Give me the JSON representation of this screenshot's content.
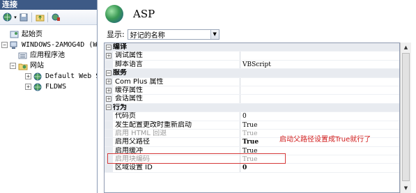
{
  "left_pane": {
    "title": "连接",
    "tree": [
      {
        "label": "起始页",
        "expander": "",
        "icon": "start-page-icon",
        "indent": 1
      },
      {
        "label": "WINDOWS-2AMOG4D (WIN",
        "expander": "⊟",
        "icon": "server-icon",
        "indent": 0
      },
      {
        "label": "应用程序池",
        "expander": "",
        "icon": "app-pool-icon",
        "indent": 2
      },
      {
        "label": "网站",
        "expander": "⊟",
        "icon": "sites-folder-icon",
        "indent": 1
      },
      {
        "label": "Default Web S:",
        "expander": "⊞",
        "icon": "website-globe-icon",
        "indent": 2
      },
      {
        "label": "FLDWS",
        "expander": "⊞",
        "icon": "website-globe-icon",
        "indent": 2
      }
    ]
  },
  "main": {
    "title": "ASP",
    "display_label": "显示:",
    "display_value": "好记的名称",
    "properties": [
      {
        "type": "category",
        "name": "编译",
        "toggle": "⊟"
      },
      {
        "type": "item",
        "name": "调试属性",
        "value": "",
        "toggle": "⊞"
      },
      {
        "type": "item",
        "name": "脚本语言",
        "value": "VBScript"
      },
      {
        "type": "category",
        "name": "服务",
        "toggle": "⊟"
      },
      {
        "type": "item",
        "name": "Com Plus 属性",
        "value": "",
        "toggle": "⊞"
      },
      {
        "type": "item",
        "name": "缓存属性",
        "value": "",
        "toggle": "⊞"
      },
      {
        "type": "item",
        "name": "会话属性",
        "value": "",
        "toggle": "⊞"
      },
      {
        "type": "category",
        "name": "行为",
        "toggle": "⊟"
      },
      {
        "type": "item",
        "name": "代码页",
        "value": "0"
      },
      {
        "type": "item",
        "name": "发生配置更改时重新启动",
        "value": "True"
      },
      {
        "type": "item",
        "name": "启用 HTML 回退",
        "value": "True",
        "disabled": true
      },
      {
        "type": "item",
        "name": "启用父路径",
        "value": "True",
        "bold": true
      },
      {
        "type": "item",
        "name": "启用缓冲",
        "value": "True"
      },
      {
        "type": "item",
        "name": "启用块编码",
        "value": "True",
        "disabled": true
      },
      {
        "type": "item",
        "name": "区域设置 ID",
        "value": "0",
        "bold": true
      }
    ],
    "annotation": "启动父路径设置成True就行了"
  },
  "colors": {
    "title_bar": "#3d5a86",
    "annotation": "#d11a1a",
    "category_bg": "#e8ebf0"
  }
}
